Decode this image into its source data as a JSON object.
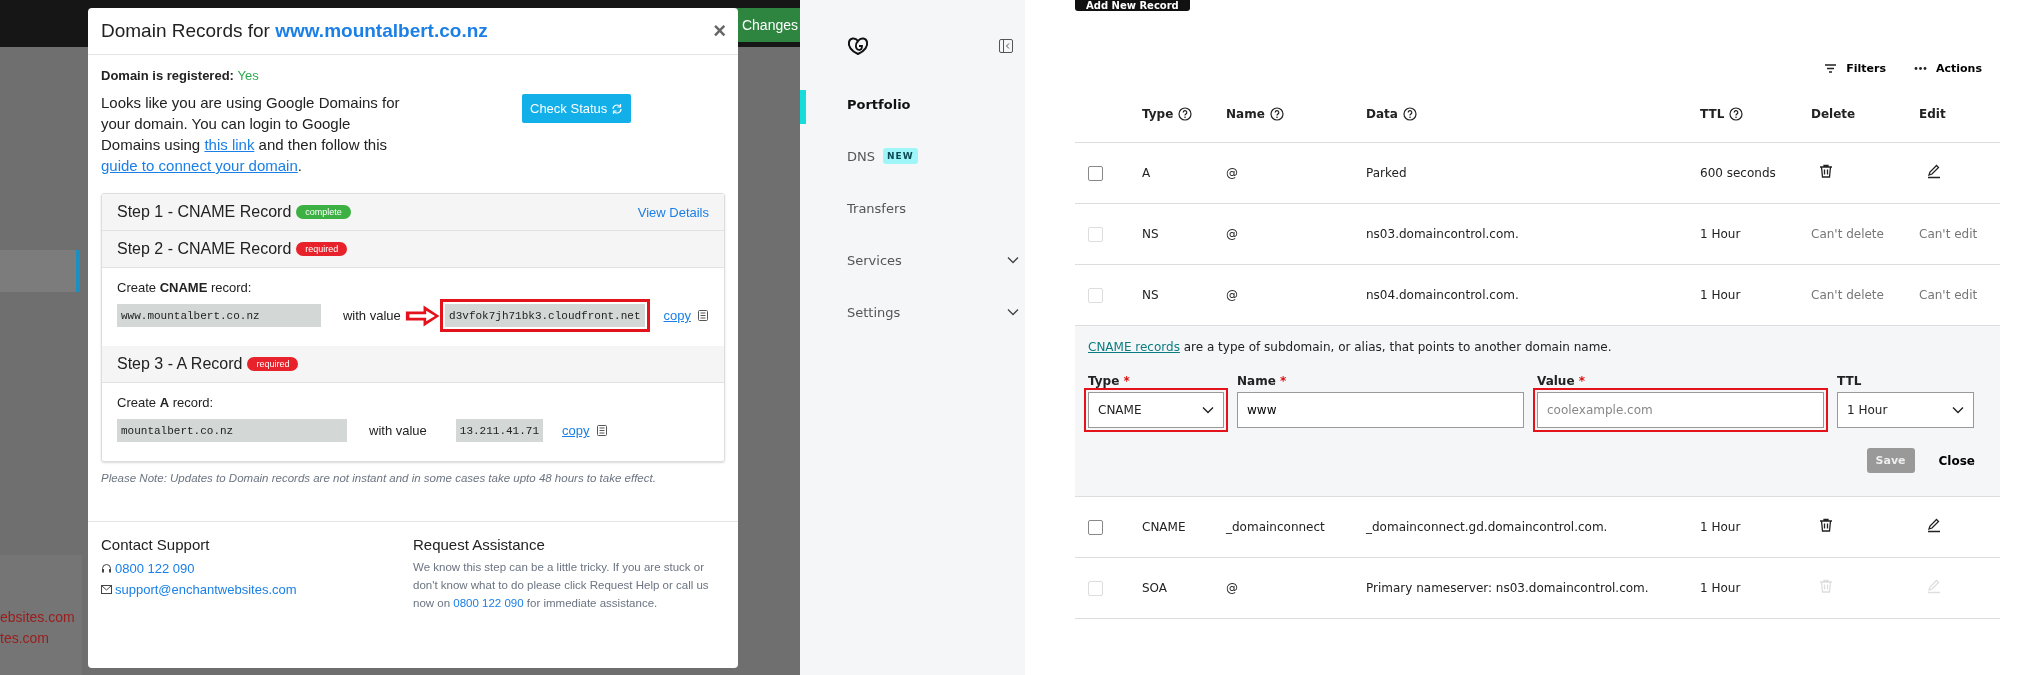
{
  "background": {
    "button": "Changes",
    "texts": [
      "ebsites.com",
      "tes.com"
    ]
  },
  "modal": {
    "title": "Domain Records for",
    "domain": "www.mountalbert.co.nz",
    "close": "×",
    "registered": {
      "label": "Domain is registered:",
      "value": "Yes"
    },
    "intro": [
      {
        "kind": "text",
        "text": "Looks like you are using Google Domains for your domain. You can login to Google Domains using "
      },
      {
        "kind": "link",
        "text": "this link"
      },
      {
        "kind": "text",
        "text": " and then follow this "
      },
      {
        "kind": "link",
        "text": "guide to connect your domain"
      },
      {
        "kind": "text",
        "text": "."
      }
    ],
    "check_button": "Check Status",
    "steps": [
      {
        "title": "Step 1 - CNAME Record",
        "badge": "complete",
        "color": "#3cb043",
        "action": "View Details"
      },
      {
        "title": "Step 2 - CNAME Record",
        "badge": "required",
        "color": "#e8222a",
        "create": "Create **CNAME** record:",
        "host": "www.mountalbert.co.nz",
        "with_value": "with value",
        "value": "d3vfok7jh71bk3.cloudfront.net",
        "highlighted": true,
        "copy": "copy"
      },
      {
        "title": "Step 3 - A Record",
        "badge": "required",
        "color": "#e8222a",
        "create": "Create **A** record:",
        "host": "mountalbert.co.nz",
        "with_value": "with value",
        "value": "13.211.41.71",
        "highlighted": false,
        "copy": "copy"
      }
    ],
    "note": "Please Note: Updates to Domain records are not instant and in some cases take upto 48 hours to take effect.",
    "contact": {
      "title": "Contact Support",
      "phone": "0800 122 090",
      "email": "support@enchantwebsites.com"
    },
    "assistance": {
      "title": "Request Assistance",
      "text": [
        {
          "kind": "text",
          "text": "We know this step can be a little tricky. If you are stuck or don't know what to do please click Request Help or call us now on "
        },
        {
          "kind": "link",
          "text": "0800 122 090"
        },
        {
          "kind": "text",
          "text": " for immediate assistance."
        }
      ]
    }
  },
  "sidebar": {
    "items": [
      {
        "label": "Portfolio",
        "selected": true,
        "expandable": false
      },
      {
        "label": "DNS",
        "badge": "NEW",
        "selected": false,
        "expandable": false
      },
      {
        "label": "Transfers",
        "selected": false,
        "expandable": false
      },
      {
        "label": "Services",
        "selected": false,
        "expandable": true
      },
      {
        "label": "Settings",
        "selected": false,
        "expandable": true
      }
    ]
  },
  "dns": {
    "add_button": "Add New Record",
    "toolbar": [
      {
        "kind": "filter",
        "label": "Filters"
      },
      {
        "kind": "more",
        "label": "Actions"
      }
    ],
    "columns": [
      {
        "label": "Type",
        "help": true
      },
      {
        "label": "Name",
        "help": true
      },
      {
        "label": "Data",
        "help": true
      },
      {
        "label": "TTL",
        "help": true
      },
      {
        "label": "Delete",
        "help": false
      },
      {
        "label": "Edit",
        "help": false
      }
    ],
    "rows": [
      {
        "kind": "record",
        "checked": false,
        "disabled": false,
        "type": "A",
        "name": "@",
        "data": "Parked",
        "ttl": "600 seconds",
        "delete": {
          "kind": "icon",
          "disabled": false
        },
        "edit": {
          "kind": "icon",
          "disabled": false
        }
      },
      {
        "kind": "record",
        "checked": false,
        "disabled": true,
        "type": "NS",
        "name": "@",
        "data": "ns03.domaincontrol.com.",
        "ttl": "1 Hour",
        "delete": {
          "kind": "text",
          "text": "Can't delete"
        },
        "edit": {
          "kind": "text",
          "text": "Can't edit"
        }
      },
      {
        "kind": "record",
        "checked": false,
        "disabled": true,
        "type": "NS",
        "name": "@",
        "data": "ns04.domaincontrol.com.",
        "ttl": "1 Hour",
        "delete": {
          "kind": "text",
          "text": "Can't delete"
        },
        "edit": {
          "kind": "text",
          "text": "Can't edit"
        }
      },
      {
        "kind": "form",
        "help_link": "CNAME records",
        "help_text": "are a type of subdomain, or alias, that points to another domain name.",
        "fields": [
          {
            "kind": "select",
            "label": "Type",
            "required_mark": "*",
            "value": "CNAME",
            "highlighted": true
          },
          {
            "kind": "input",
            "label": "Name",
            "required_mark": "*",
            "value": "www",
            "highlighted": false
          },
          {
            "kind": "input",
            "label": "Value",
            "required_mark": "*",
            "placeholder": "coolexample.com",
            "highlighted": true
          },
          {
            "kind": "select",
            "label": "TTL",
            "value": "1 Hour",
            "highlighted": false
          }
        ],
        "save": {
          "label": "Save",
          "disabled": true
        },
        "close": "Close"
      },
      {
        "kind": "record",
        "checked": false,
        "disabled": false,
        "type": "CNAME",
        "name": "_domainconnect",
        "data": "_domainconnect.gd.domaincontrol.com.",
        "ttl": "1 Hour",
        "delete": {
          "kind": "icon",
          "disabled": false
        },
        "edit": {
          "kind": "icon",
          "disabled": false
        }
      },
      {
        "kind": "record",
        "checked": false,
        "disabled": true,
        "type": "SOA",
        "name": "@",
        "data": "Primary nameserver: ns03.domaincontrol.com.",
        "ttl": "1 Hour",
        "delete": {
          "kind": "icon",
          "disabled": true
        },
        "edit": {
          "kind": "icon",
          "disabled": true
        }
      }
    ]
  }
}
